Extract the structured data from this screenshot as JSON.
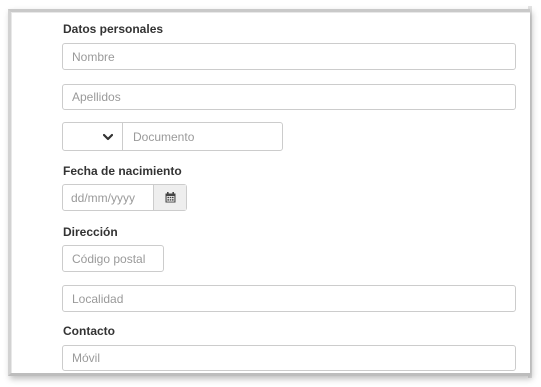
{
  "sections": {
    "personal": "Datos personales",
    "birth": "Fecha de nacimiento",
    "address": "Dirección",
    "contact": "Contacto"
  },
  "fields": {
    "nombre": "Nombre",
    "apellidos": "Apellidos",
    "documento": "Documento",
    "fecha": "dd/mm/yyyy",
    "codigo_postal": "Código postal",
    "localidad": "Localidad",
    "movil": "Móvil"
  },
  "document_type": {
    "selected": ""
  },
  "icons": {
    "select": "chevron-down-icon",
    "date": "calendar-icon"
  }
}
